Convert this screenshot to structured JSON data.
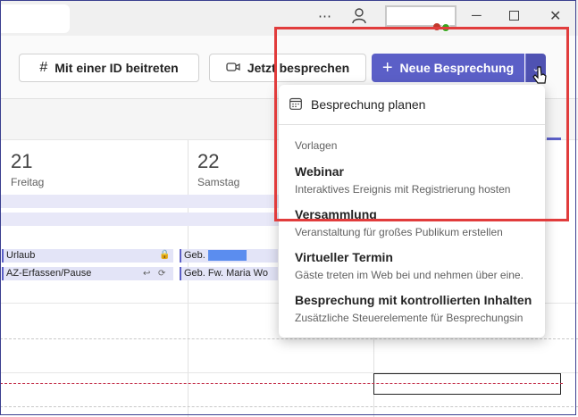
{
  "toolbar": {
    "join_label": "Mit einer ID beitreten",
    "now_label": "Jetzt besprechen",
    "new_label": "Neue Besprechung"
  },
  "calendar": {
    "days": [
      {
        "number": "21",
        "name": "Freitag"
      },
      {
        "number": "22",
        "name": "Samstag"
      }
    ],
    "events": {
      "urlaub": "Urlaub",
      "az": "AZ-Erfassen/Pause",
      "geb1": "Geb.",
      "geb2": "Geb. Fw. Maria Wo"
    }
  },
  "menu": {
    "plan_label": "Besprechung planen",
    "section_label": "Vorlagen",
    "items": [
      {
        "title": "Webinar",
        "subtitle": "Interaktives Ereignis mit Registrierung hosten"
      },
      {
        "title": "Versammlung",
        "subtitle": "Veranstaltung für großes Publikum erstellen"
      },
      {
        "title": "Virtueller Termin",
        "subtitle": "Gäste treten im Web bei und nehmen über eine..."
      },
      {
        "title": "Besprechung mit kontrollierten Inhalten",
        "subtitle": "Zusätzliche Steuerelemente für Besprechungsinh..."
      }
    ]
  },
  "icons": {
    "join": "hash-icon",
    "now": "video-camera-icon",
    "new": "plus-icon",
    "plan": "calendar-icon"
  },
  "colors": {
    "accent": "#5b5fc7",
    "highlight": "#e13c3c"
  }
}
